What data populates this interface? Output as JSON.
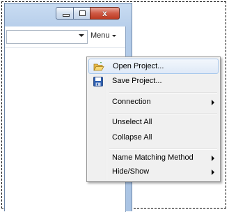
{
  "window": {
    "menu_label": "Menu",
    "close_glyph": "x"
  },
  "context_menu": {
    "items": [
      {
        "label": "Open Project...",
        "icon": "folder-open-icon"
      },
      {
        "label": "Save Project...",
        "icon": "floppy-disk-icon"
      },
      {
        "label": "Connection",
        "submenu": true
      },
      {
        "label": "Unselect All"
      },
      {
        "label": "Collapse All"
      },
      {
        "label": "Name Matching Method",
        "submenu": true
      },
      {
        "label": "Hide/Show",
        "submenu": true
      }
    ]
  },
  "colors": {
    "menu_bg": "#f0f0f0",
    "hover_border": "#a8c8ec",
    "close_button": "#cf5a45"
  }
}
